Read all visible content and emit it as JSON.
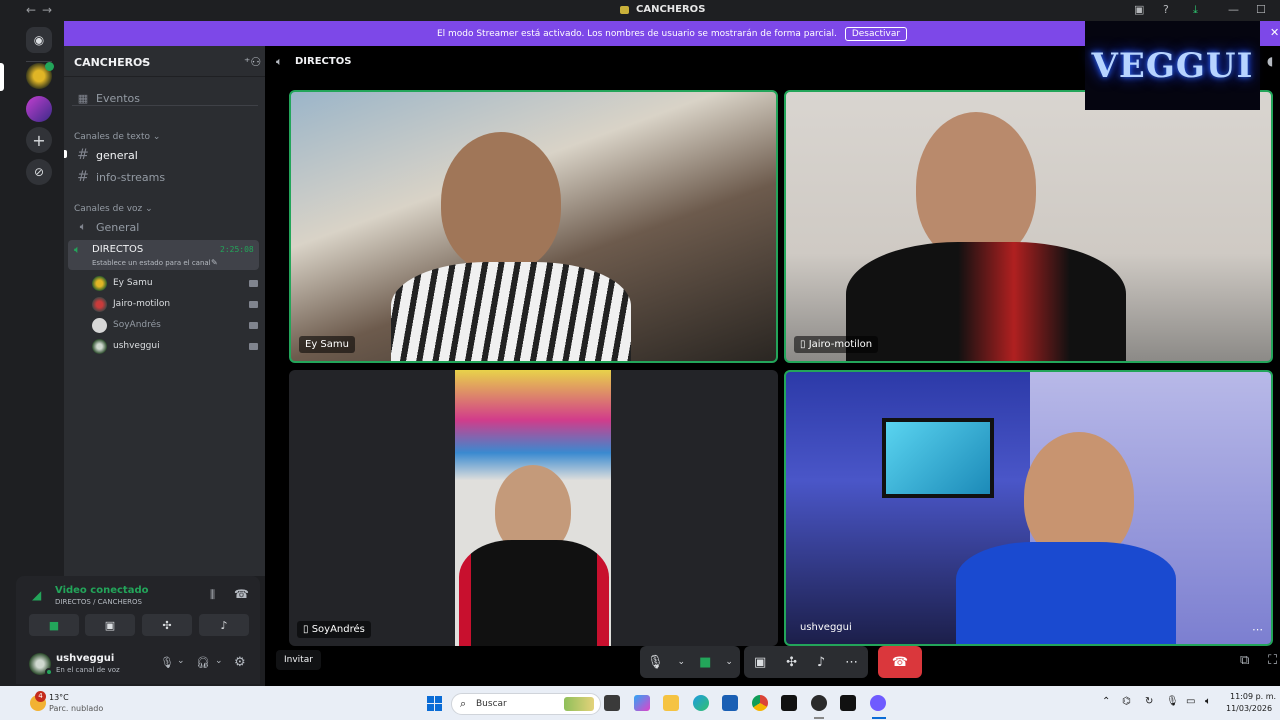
{
  "titlebar": {
    "title": "CANCHEROS"
  },
  "banner": {
    "message": "El modo Streamer está activado. Los nombres de usuario se mostrarán de forma parcial.",
    "button": "Desactivar"
  },
  "server": {
    "name": "CANCHEROS",
    "events": "Eventos"
  },
  "text_category": "Canales de texto",
  "text_channels": [
    "general",
    "info-streams"
  ],
  "voice_category": "Canales de voz",
  "voice_channels": {
    "general": "General",
    "active": "DIRECTOS",
    "active_timer": "2:25:08",
    "active_status": "Establece un estado para el canal"
  },
  "members": [
    "Ey Samu",
    "Jairo-motilon",
    "SoyAndrés",
    "ushveggui"
  ],
  "voice_panel": {
    "status": "Video conectado",
    "location": "DIRECTOS / CANCHEROS"
  },
  "user": {
    "name": "ushveggui",
    "status": "En el canal de voz"
  },
  "stage": {
    "channel": "DIRECTOS",
    "tiles": [
      "Ey Samu",
      "Jairo-motilon",
      "SoyAndrés",
      "ushveggui"
    ],
    "overlay_logo": "VEGGUI",
    "invite": "Invitar"
  },
  "taskbar": {
    "temp": "13°C",
    "weather": "Parc. nublado",
    "search": "Buscar",
    "time": "11:09 p. m.",
    "date": "11/03/2026",
    "weather_badge": "4"
  }
}
